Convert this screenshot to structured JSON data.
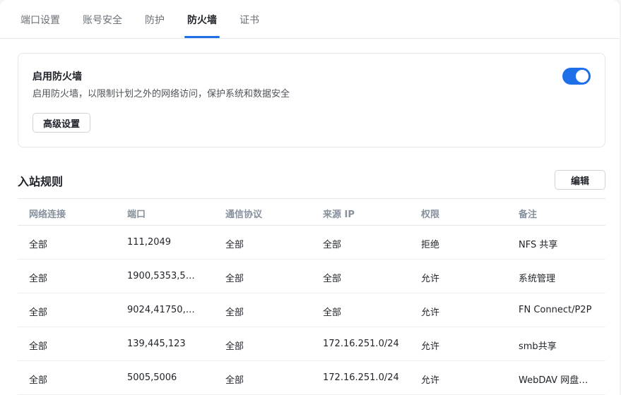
{
  "tabs": [
    {
      "label": "端口设置"
    },
    {
      "label": "账号安全"
    },
    {
      "label": "防护"
    },
    {
      "label": "防火墙",
      "active": true
    },
    {
      "label": "证书"
    }
  ],
  "firewall": {
    "title": "启用防火墙",
    "description": "启用防火墙，以限制计划之外的网络访问，保护系统和数据安全",
    "advanced_label": "高级设置",
    "enabled": true
  },
  "inbound": {
    "title": "入站规则",
    "edit_label": "编辑",
    "columns": [
      "网络连接",
      "端口",
      "通信协议",
      "来源 IP",
      "权限",
      "备注"
    ],
    "rows": [
      [
        "全部",
        "111,2049",
        "全部",
        "全部",
        "拒绝",
        "NFS 共享"
      ],
      [
        "全部",
        "1900,5353,53…",
        "全部",
        "全部",
        "允许",
        "系统管理"
      ],
      [
        "全部",
        "9024,41750,4…",
        "全部",
        "全部",
        "允许",
        "FN Connect/P2P"
      ],
      [
        "全部",
        "139,445,123",
        "全部",
        "172.16.251.0/24",
        "允许",
        "smb共享"
      ],
      [
        "全部",
        "5005,5006",
        "全部",
        "172.16.251.0/24",
        "允许",
        "WebDAV 网盘…"
      ]
    ]
  },
  "colors": {
    "accent": "#1f6fe8",
    "text": "#1f2329",
    "muted": "#86909c"
  }
}
